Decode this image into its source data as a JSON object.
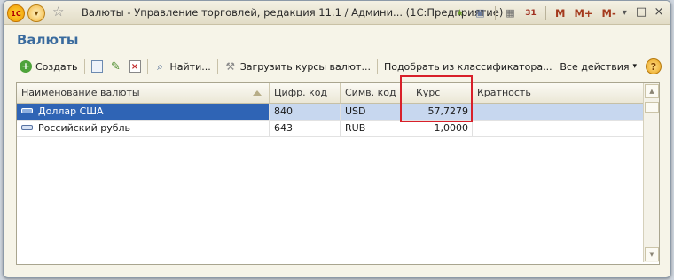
{
  "window": {
    "title": "Валюты - Управление торговлей, редакция 11.1 / Админи...   (1С:Предприятие)",
    "logo_text": "1C",
    "mem_buttons": [
      "M",
      "M+",
      "M-"
    ]
  },
  "page": {
    "heading": "Валюты"
  },
  "toolbar": {
    "create": "Создать",
    "find": "Найти...",
    "load_rates": "Загрузить курсы валют...",
    "pick_classifier": "Подобрать из классификатора...",
    "all_actions": "Все действия",
    "help": "?"
  },
  "table": {
    "columns": [
      "Наименование валюты",
      "Цифр. код",
      "Симв. код",
      "Курс",
      "Кратность"
    ],
    "rows": [
      {
        "name": "Доллар США",
        "num_code": "840",
        "sym_code": "USD",
        "rate": "57,7279",
        "mult": "",
        "selected": true
      },
      {
        "name": "Российский рубль",
        "num_code": "643",
        "sym_code": "RUB",
        "rate": "1,0000",
        "mult": "",
        "selected": false
      }
    ]
  },
  "colors": {
    "heading": "#3a6b9e",
    "selection": "#2f64b5",
    "highlight_box": "#d8202a"
  }
}
